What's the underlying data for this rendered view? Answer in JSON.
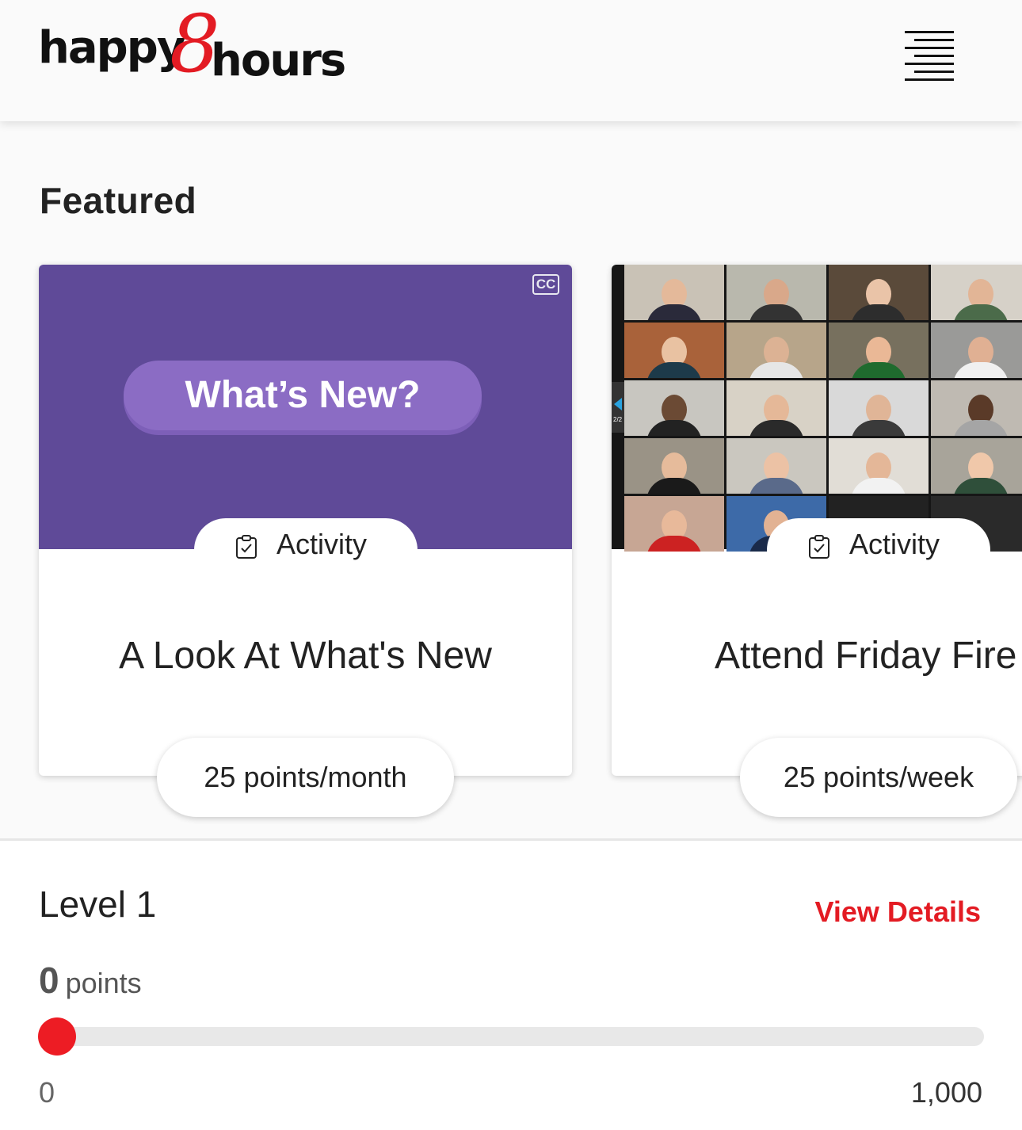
{
  "header": {
    "logo_part1": "happy",
    "logo_eight": "8",
    "logo_part2": "hours",
    "menu_icon": "hamburger-menu-icon",
    "brand_color": "#e31b23"
  },
  "featured": {
    "title": "Featured",
    "cards": [
      {
        "thumbnail_text": "What’s New?",
        "cc_label": "CC",
        "type_label": "Activity",
        "type_icon": "clipboard-check-icon",
        "title": "A Look At What's New",
        "points": "25 points/month",
        "thumbnail_color": "#5f4a98"
      },
      {
        "thumbnail_description": "video-call-grid",
        "page_indicator": "2/2",
        "type_label": "Activity",
        "type_icon": "clipboard-check-icon",
        "title": "Attend Friday Fire",
        "points": "25 points/week"
      }
    ]
  },
  "level": {
    "title": "Level 1",
    "view_details": "View Details",
    "points_value": "0",
    "points_label": "points",
    "progress_fraction": 0,
    "range_min": "0",
    "range_max": "1,000",
    "progress_color": "#ed1c24"
  }
}
